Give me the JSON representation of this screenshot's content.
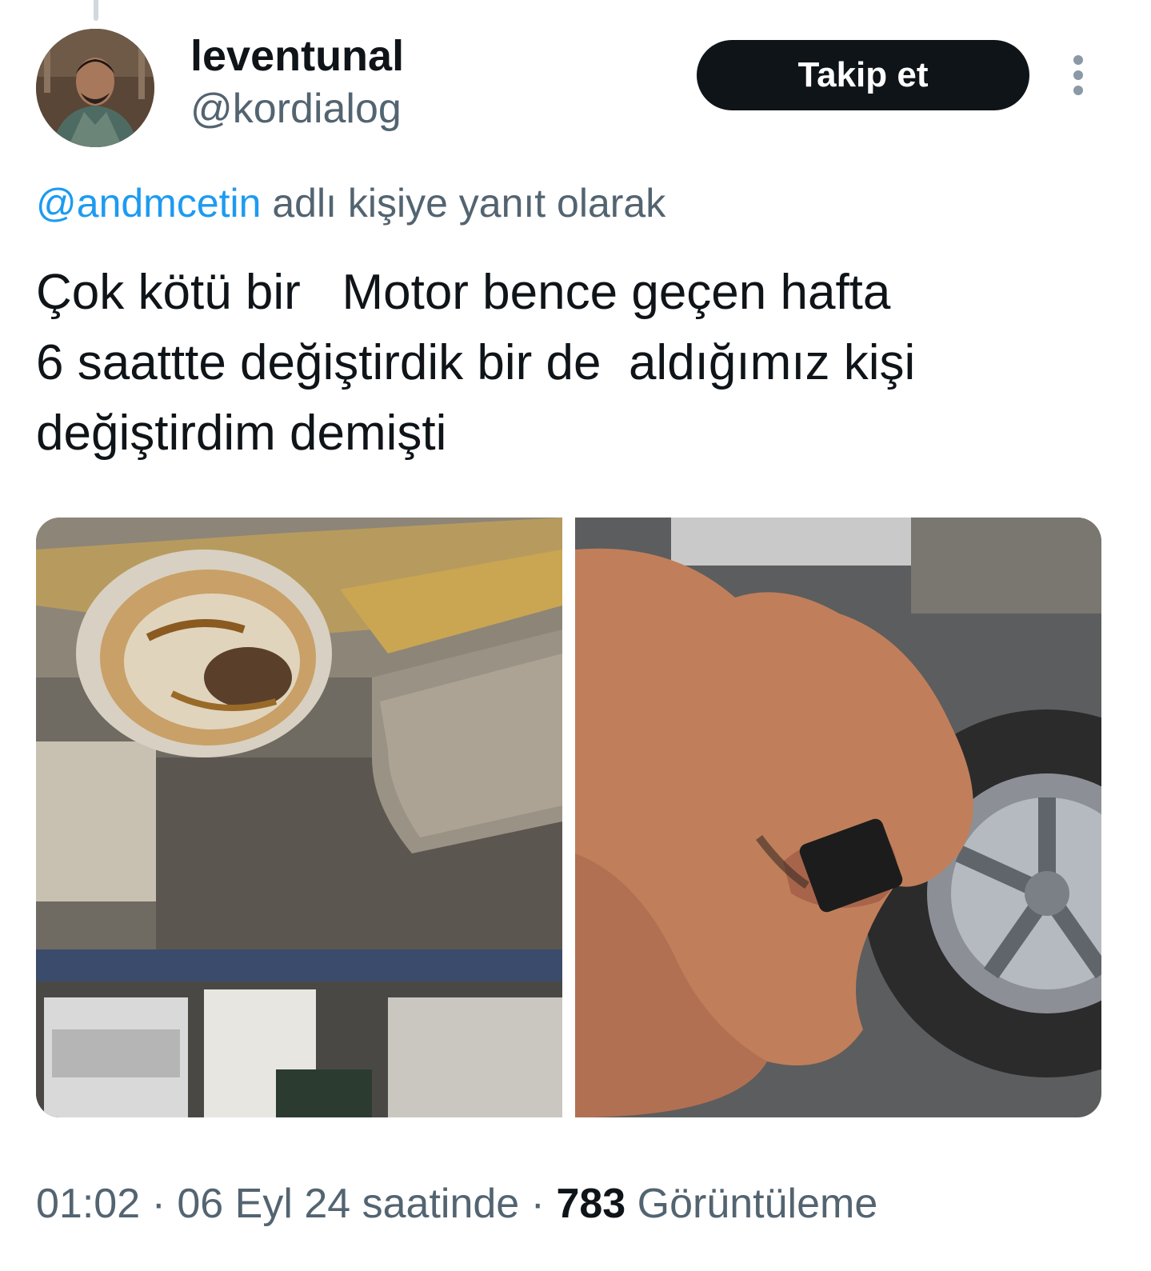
{
  "user": {
    "display_name": "leventunal",
    "handle": "@kordialog"
  },
  "follow_button": {
    "label": "Takip et"
  },
  "more_icon": "more-vertical-icon",
  "reply_context": {
    "mention": "@andmcetin",
    "suffix": " adlı kişiye yanıt olarak"
  },
  "tweet": {
    "lines": [
      "Çok kötü bir   Motor bence geçen hafta",
      "6 saattte değiştirdik bir de  aldığımız kişi",
      "değiştirdim demişti"
    ]
  },
  "media": [
    {
      "alt": "Arabanın altından çekilmiş yağ karteri fotoğrafı"
    },
    {
      "alt": "Elinde parça tutan tamirci fotoğrafı"
    }
  ],
  "meta": {
    "time": "01:02",
    "sep1": " · ",
    "date": "06 Eyl 24 saatinde",
    "sep2": " · ",
    "views_count": "783",
    "views_label": " Görüntüleme"
  },
  "colors": {
    "text": "#0f1419",
    "secondary": "#536471",
    "accent": "#1d9bf0",
    "button_bg": "#0f1419"
  }
}
